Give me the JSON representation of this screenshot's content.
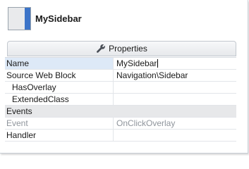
{
  "header": {
    "title": "MySidebar",
    "icon": "sidebar-widget-icon"
  },
  "tab": {
    "label": "Properties",
    "icon": "wrench-icon"
  },
  "properties": [
    {
      "name": "Name",
      "value": "MySidebar"
    },
    {
      "name": "Source Web Block",
      "value": "Navigation\\Sidebar"
    },
    {
      "name": "HasOverlay",
      "value": ""
    },
    {
      "name": "ExtendedClass",
      "value": ""
    }
  ],
  "events": {
    "category": "Events",
    "items": [
      {
        "name": "Event",
        "value": "OnClickOverlay"
      },
      {
        "name": "Handler",
        "value": ""
      }
    ]
  },
  "colors": {
    "accent": "#3c74c8",
    "category_bg": "#e7e8ea",
    "border": "#c9ced6"
  }
}
